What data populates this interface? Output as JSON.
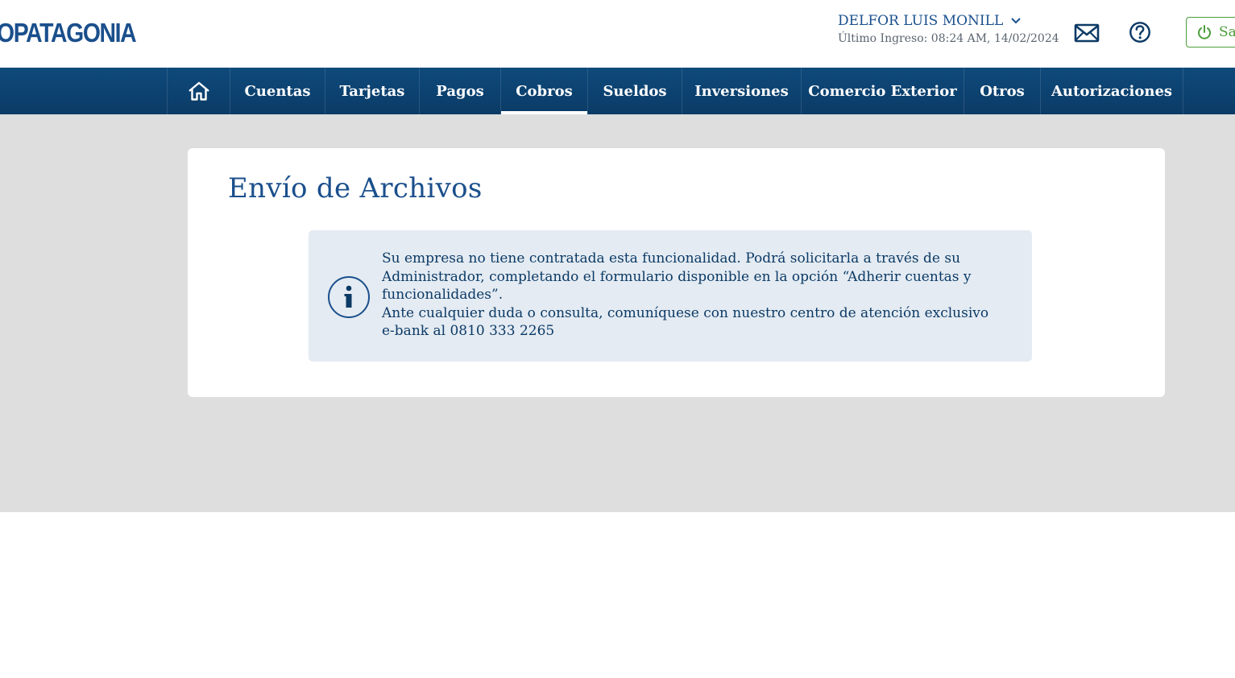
{
  "header": {
    "logo_text": "OPATAGONIA",
    "user_name": "DELFOR LUIS MONILL",
    "last_login": "Último Ingreso: 08:24 AM, 14/02/2024",
    "logout_label": "Salir",
    "icons": {
      "user_menu": "chevron-down-icon",
      "mail": "mail-icon",
      "help": "help-icon",
      "logout": "power-icon"
    }
  },
  "nav": {
    "home_icon": "home-icon",
    "items": [
      {
        "label": "Cuentas"
      },
      {
        "label": "Tarjetas"
      },
      {
        "label": "Pagos"
      },
      {
        "label": "Cobros",
        "active": true
      },
      {
        "label": "Sueldos"
      },
      {
        "label": "Inversiones"
      },
      {
        "label": "Comercio Exterior"
      },
      {
        "label": "Otros"
      },
      {
        "label": "Autorizaciones"
      }
    ]
  },
  "main": {
    "title": "Envío de Archivos",
    "info": {
      "icon": "info-icon",
      "line1": "Su empresa no tiene contratada esta funcionalidad. Podrá solicitarla a través de su Administrador, completando el formulario disponible en la opción “Adherir cuentas y funcionalidades”.",
      "line2": "Ante cualquier duda o consulta, comuníquese con nuestro centro de atención exclusivo e-bank al 0810 333 2265"
    }
  },
  "colors": {
    "brand_blue": "#1a4f8c",
    "nav_bg": "#0b3b66",
    "logout_green": "#4a9e3a",
    "page_bg": "#dedede",
    "info_bg": "#e4ebf2"
  }
}
